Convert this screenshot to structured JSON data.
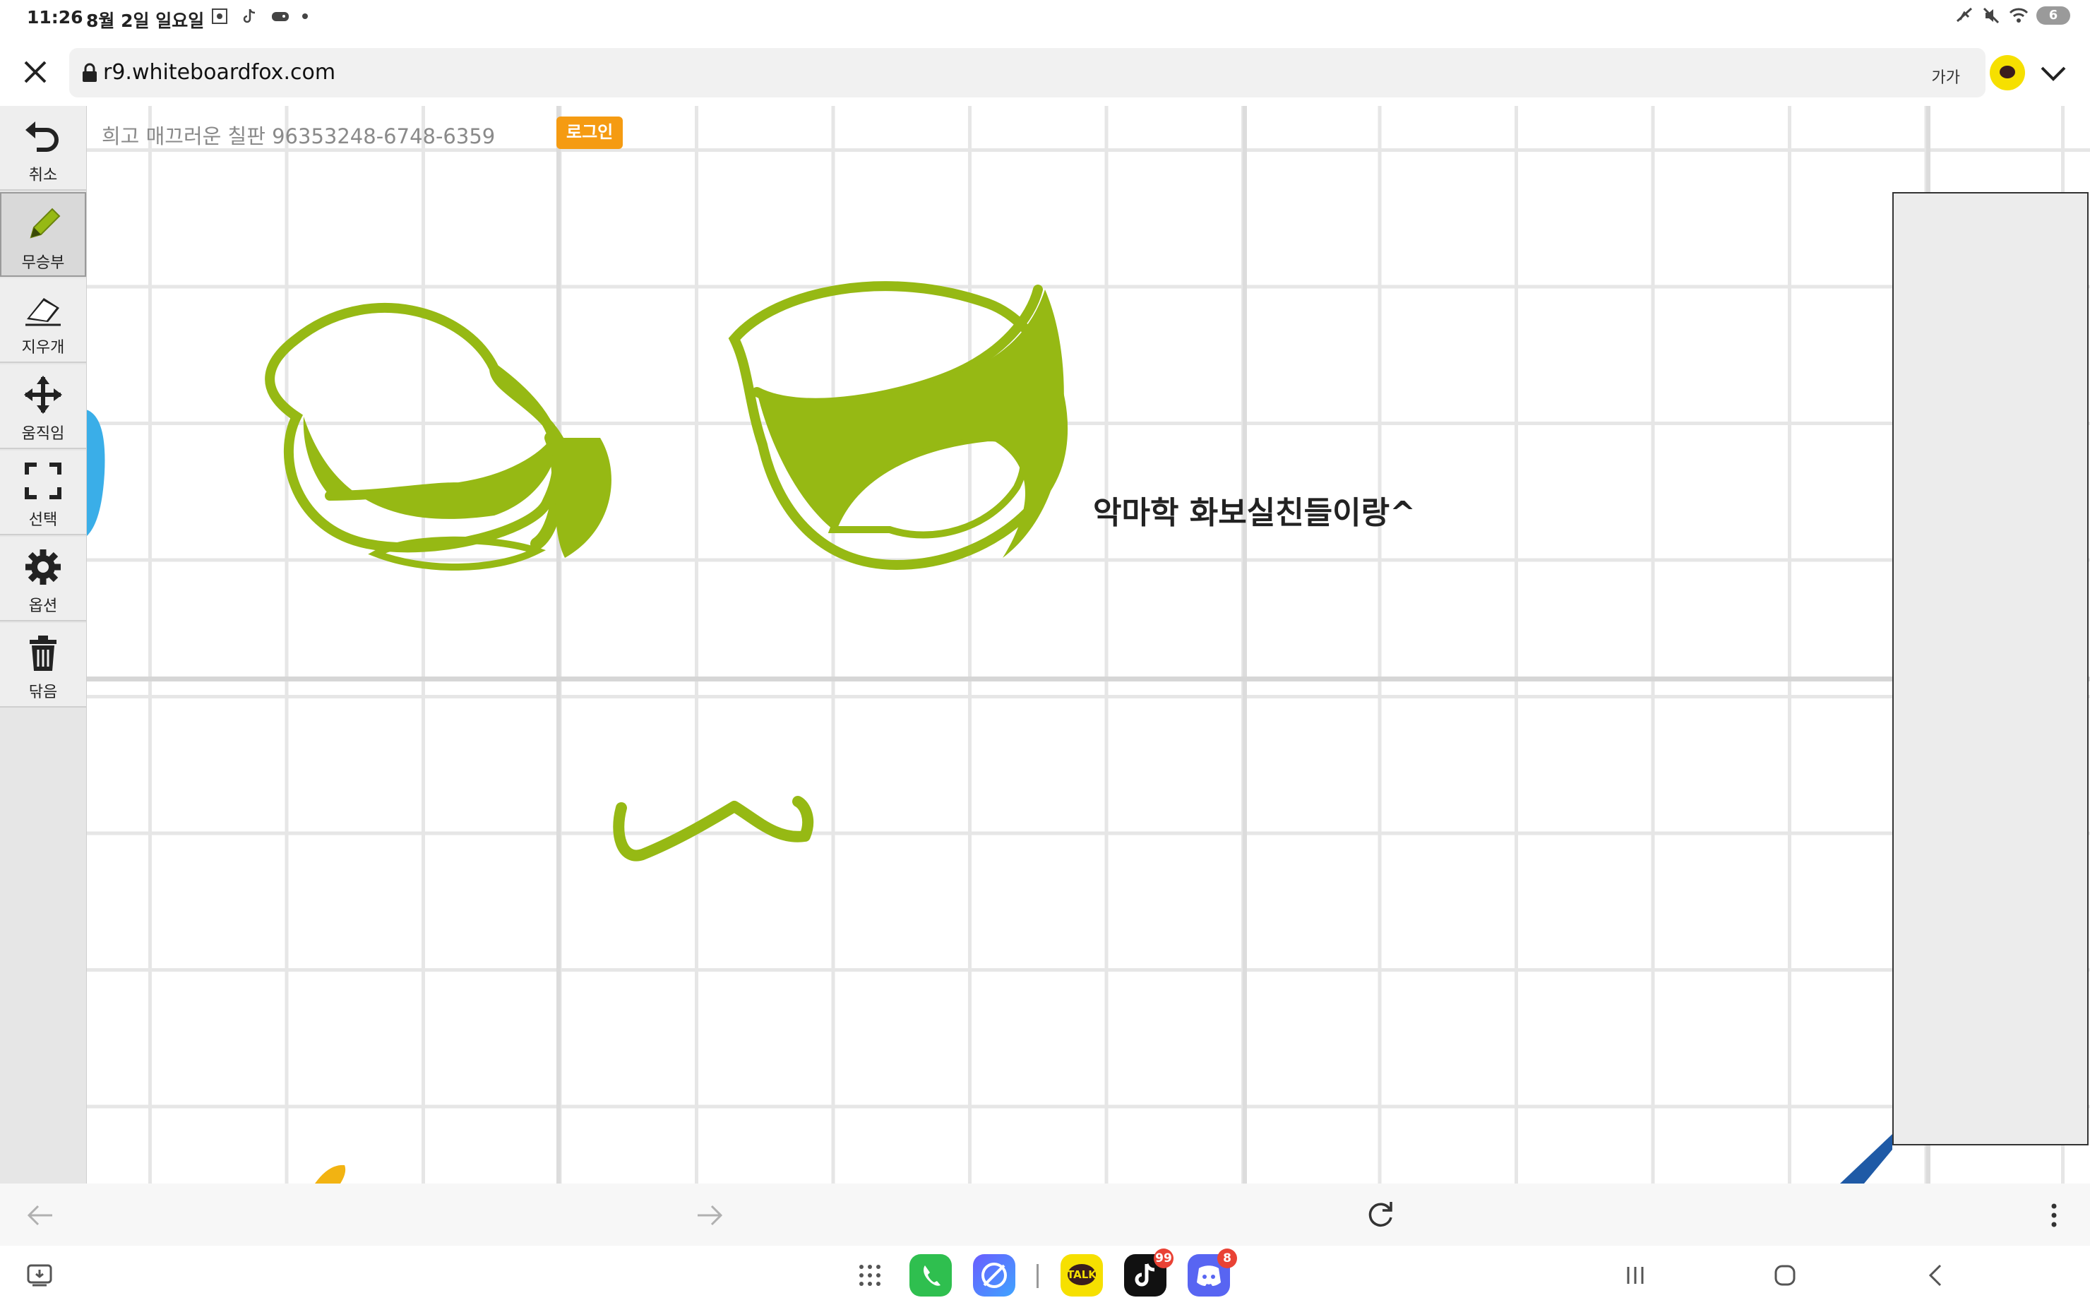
{
  "status_bar": {
    "time": "11:26",
    "date": "8월 2일 일요일",
    "notification_icons": [
      "screenshot-icon",
      "tiktok-icon",
      "game-icon"
    ],
    "battery": "6"
  },
  "browser": {
    "url": "r9.whiteboardfox.com",
    "text_size_label": "가가"
  },
  "toolbar": {
    "tools": [
      {
        "label": "취소",
        "icon": "undo-icon"
      },
      {
        "label": "무승부",
        "icon": "pencil-icon",
        "active": true
      },
      {
        "label": "지우개",
        "icon": "eraser-icon"
      },
      {
        "label": "움직임",
        "icon": "move-icon"
      },
      {
        "label": "선택",
        "icon": "select-icon"
      },
      {
        "label": "옵션",
        "icon": "gear-icon"
      },
      {
        "label": "닦음",
        "icon": "trash-icon"
      }
    ]
  },
  "board": {
    "board_id_text": "희고 매끄러운 칠판 96353248-6748-6359",
    "login_label": "로그인",
    "handwritten_text": "악마학 화보실친들이랑^",
    "ink_color": "#96b914"
  },
  "dock": {
    "apps": [
      {
        "name": "phone",
        "badge": null
      },
      {
        "name": "internet",
        "badge": null
      },
      {
        "name": "kakaotalk",
        "label": "TALK",
        "badge": null
      },
      {
        "name": "tiktok",
        "badge": "99"
      },
      {
        "name": "discord",
        "badge": "8"
      }
    ]
  },
  "colors": {
    "accent_orange": "#f59b12",
    "kakao_yellow": "#f6e000",
    "discord_blue": "#5865f2"
  }
}
